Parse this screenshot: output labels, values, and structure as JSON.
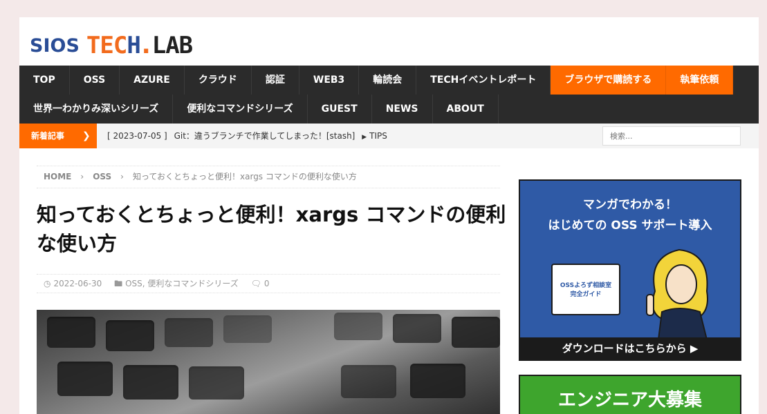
{
  "logo": {
    "sios": "SIOS",
    "tech_t": "TEC",
    "tech_h": "H",
    "dot": ".",
    "lab": "LAB"
  },
  "nav": {
    "row1": [
      {
        "label": "TOP"
      },
      {
        "label": "OSS"
      },
      {
        "label": "AZURE"
      },
      {
        "label": "クラウド"
      },
      {
        "label": "認証"
      },
      {
        "label": "WEB3"
      },
      {
        "label": "輪読会"
      },
      {
        "label": "TECHイベントレポート"
      },
      {
        "label": "ブラウザで購読する"
      },
      {
        "label": "執筆依頼"
      }
    ],
    "row2": [
      {
        "label": "世界一わかりみ深いシリーズ"
      },
      {
        "label": "便利なコマンドシリーズ"
      },
      {
        "label": "GUEST"
      },
      {
        "label": "NEWS"
      },
      {
        "label": "ABOUT"
      }
    ],
    "accent_color": "#ff6a00"
  },
  "ticker": {
    "label": "新着記事",
    "date": "[ 2023-07-05 ]",
    "headline": "Git：違うブランチで作業してしまった！[stash]",
    "tag": "TIPS"
  },
  "search": {
    "placeholder": "検索..."
  },
  "breadcrumb": {
    "home": "HOME",
    "category": "OSS",
    "current": "知っておくとちょっと便利！xargs コマンドの便利な使い方"
  },
  "article": {
    "title": "知っておくとちょっと便利！xargs コマンドの便利な使い方",
    "date": "2022-06-30",
    "categories": "OSS, 便利なコマンドシリーズ",
    "comments": "0"
  },
  "sidebar": {
    "ad1": {
      "title_line1": "マンガでわかる！",
      "title_line2": "はじめての OSS サポート導入",
      "book_line1": "OSSよろず相談室",
      "book_line2": "完全ガイド",
      "cta": "ダウンロードはこちらから ▶"
    },
    "ad2": {
      "title": "エンジニア大募集"
    }
  }
}
